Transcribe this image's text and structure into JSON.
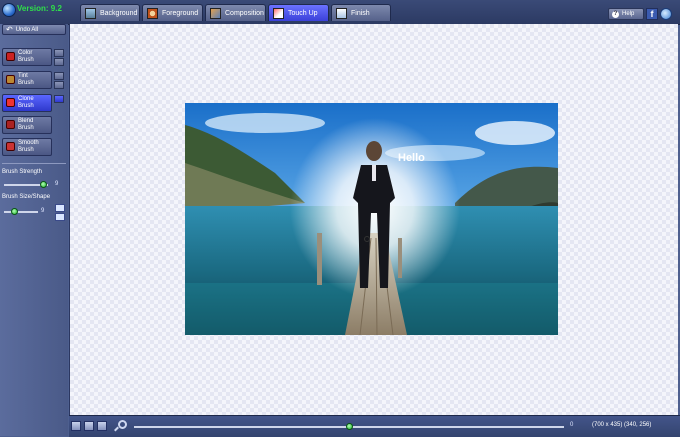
{
  "app": {
    "version": "Version: 9.2"
  },
  "tabs": [
    {
      "label": "Background",
      "icon": "background-icon",
      "active": false
    },
    {
      "label": "Foreground",
      "icon": "foreground-icon",
      "active": false
    },
    {
      "label": "Composition",
      "icon": "composition-icon",
      "active": false
    },
    {
      "label": "Touch Up",
      "icon": "touchup-icon",
      "active": true
    },
    {
      "label": "Finish",
      "icon": "finish-icon",
      "active": false
    }
  ],
  "header": {
    "help_label": "Help",
    "facebook_label": "f"
  },
  "left_panel": {
    "undo_label": "Undo All",
    "brushes": [
      {
        "line1": "Color",
        "line2": "Brush",
        "active": false
      },
      {
        "line1": "Tint",
        "line2": "Brush",
        "active": false
      },
      {
        "line1": "Clone",
        "line2": "Brush",
        "active": true
      },
      {
        "line1": "Blend",
        "line2": "Brush",
        "active": false
      },
      {
        "line1": "Smooth",
        "line2": "Brush",
        "active": false
      }
    ],
    "brush_strength": {
      "label": "Brush Strength",
      "value": "9",
      "level": 0.9
    },
    "brush_size": {
      "label": "Brush Size/Shape",
      "value": "9",
      "level": 0.3
    }
  },
  "canvas": {
    "photo_text": "Hello"
  },
  "bottom": {
    "zoom_value": "0",
    "zoom_level": 0.5,
    "coords": "(700 x 435) (340, 256)"
  },
  "colors": {
    "accent": "#3a40d9",
    "panel": "#4d5f8f",
    "version_green": "#2fe04a"
  }
}
